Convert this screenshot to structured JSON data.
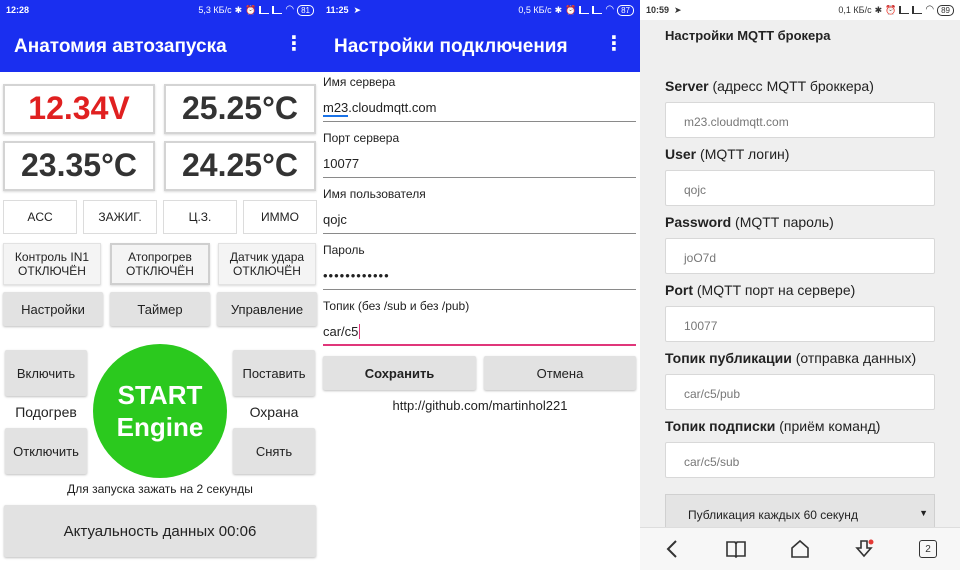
{
  "panel1": {
    "status": {
      "time": "12:28",
      "speed": "5,3 КБ/с",
      "battery": "81"
    },
    "title": "Анатомия автозапуска",
    "values": [
      "12.34V",
      "25.25°C",
      "23.35°C",
      "24.25°C"
    ],
    "voltage_color": "#e02020",
    "status_buttons": [
      "ACC",
      "ЗАЖИГ.",
      "Ц.З.",
      "ИММО"
    ],
    "toggles": [
      {
        "line1": "Контроль IN1",
        "line2": "ОТКЛЮЧЁН"
      },
      {
        "line1": "Атопрогрев",
        "line2": "ОТКЛЮЧЁН"
      },
      {
        "line1": "Датчик удара",
        "line2": "ОТКЛЮЧЁН"
      }
    ],
    "nav_buttons": [
      "Настройки",
      "Таймер",
      "Управление"
    ],
    "heat_on": "Включить",
    "heat_label": "Подогрев",
    "heat_off": "Отключить",
    "start_line1": "START",
    "start_line2": "Engine",
    "guard_set": "Поставить",
    "guard_label": "Охрана",
    "guard_unset": "Снять",
    "hint": "Для запуска зажать на 2 секунды",
    "freshness": "Актуальность данных 00:06"
  },
  "panel2": {
    "status": {
      "time": "11:25",
      "speed": "0,5 КБ/с",
      "battery": "87"
    },
    "title": "Настройки подключения",
    "fields": [
      {
        "label": "Имя сервера",
        "value_hl": "m23",
        "value_rest": ".cloudmqtt.com"
      },
      {
        "label": "Порт сервера",
        "value": "10077"
      },
      {
        "label": "Имя пользователя",
        "value": "qojc"
      },
      {
        "label": "Пароль",
        "value": "••••••••••••"
      },
      {
        "label": "Топик (без /sub и без /pub)",
        "value": "car/c5"
      }
    ],
    "save": "Сохранить",
    "cancel": "Отмена",
    "link": "http://github.com/martinhol221"
  },
  "panel3": {
    "status": {
      "time": "10:59",
      "speed": "0,1 КБ/с",
      "battery": "89"
    },
    "heading": "Настройки MQTT брокера",
    "fields": [
      {
        "bold": "Server",
        "rest": " (адресс MQTT броккера)",
        "value": "m23.cloudmqtt.com"
      },
      {
        "bold": "User",
        "rest": " (MQTT логин)",
        "value": "qojc"
      },
      {
        "bold": "Password",
        "rest": " (MQTT пароль)",
        "value": "joO7d"
      },
      {
        "bold": "Port",
        "rest": " (MQTT порт на сервере)",
        "value": "10077"
      },
      {
        "bold": "Топик публикации",
        "rest": " (отправка данных)",
        "value": "car/c5/pub"
      },
      {
        "bold": "Топик подписки",
        "rest": " (приём команд)",
        "value": "car/c5/sub"
      }
    ],
    "select_value": "Публикация каждых 60 секунд",
    "tab_count": "2"
  },
  "icons": [
    "overflow-menu-icon",
    "bluetooth-icon",
    "alarm-icon",
    "signal-icon",
    "wifi-icon",
    "battery-icon",
    "telegram-icon",
    "back-icon",
    "book-icon",
    "home-icon",
    "download-icon",
    "tabs-icon",
    "dropdown-arrow-icon"
  ]
}
